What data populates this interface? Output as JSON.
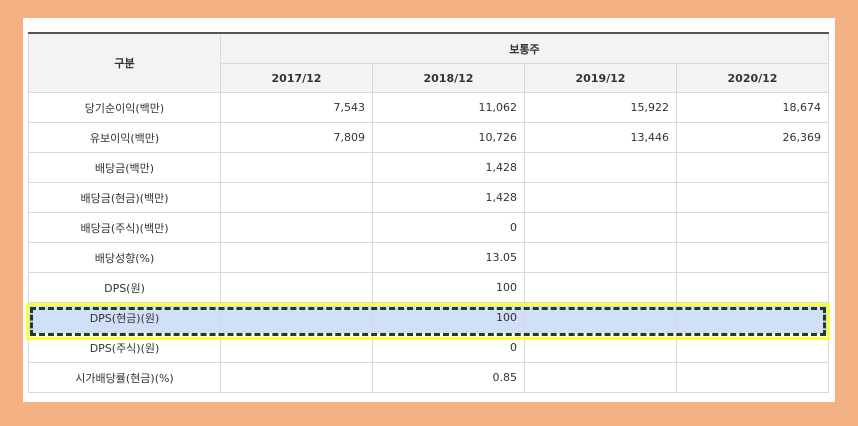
{
  "table": {
    "header": {
      "category": "구분",
      "group": "보통주",
      "years": [
        "2017/12",
        "2018/12",
        "2019/12",
        "2020/12"
      ]
    },
    "rows": [
      {
        "label": "당기순이익(백만)",
        "values": [
          "7,543",
          "11,062",
          "15,922",
          "18,674"
        ]
      },
      {
        "label": "유보이익(백만)",
        "values": [
          "7,809",
          "10,726",
          "13,446",
          "26,369"
        ]
      },
      {
        "label": "배당금(백만)",
        "values": [
          "",
          "1,428",
          "",
          ""
        ]
      },
      {
        "label": "배당금(현금)(백만)",
        "values": [
          "",
          "1,428",
          "",
          ""
        ]
      },
      {
        "label": "배당금(주식)(백만)",
        "values": [
          "",
          "0",
          "",
          ""
        ]
      },
      {
        "label": "배당성향(%)",
        "values": [
          "",
          "13.05",
          "",
          ""
        ]
      },
      {
        "label": "DPS(원)",
        "values": [
          "",
          "100",
          "",
          ""
        ]
      },
      {
        "label": "DPS(현금)(원)",
        "values": [
          "",
          "100",
          "",
          ""
        ],
        "highlighted": true
      },
      {
        "label": "DPS(주식)(원)",
        "values": [
          "",
          "0",
          "",
          ""
        ]
      },
      {
        "label": "시가배당률(현금)(%)",
        "values": [
          "",
          "0.85",
          "",
          ""
        ]
      }
    ]
  },
  "colors": {
    "frame": "#f4b183",
    "highlight_fill": "#cfe0f7",
    "highlight_outline": "#ffff33",
    "highlight_dash": "#1f3b2e"
  }
}
